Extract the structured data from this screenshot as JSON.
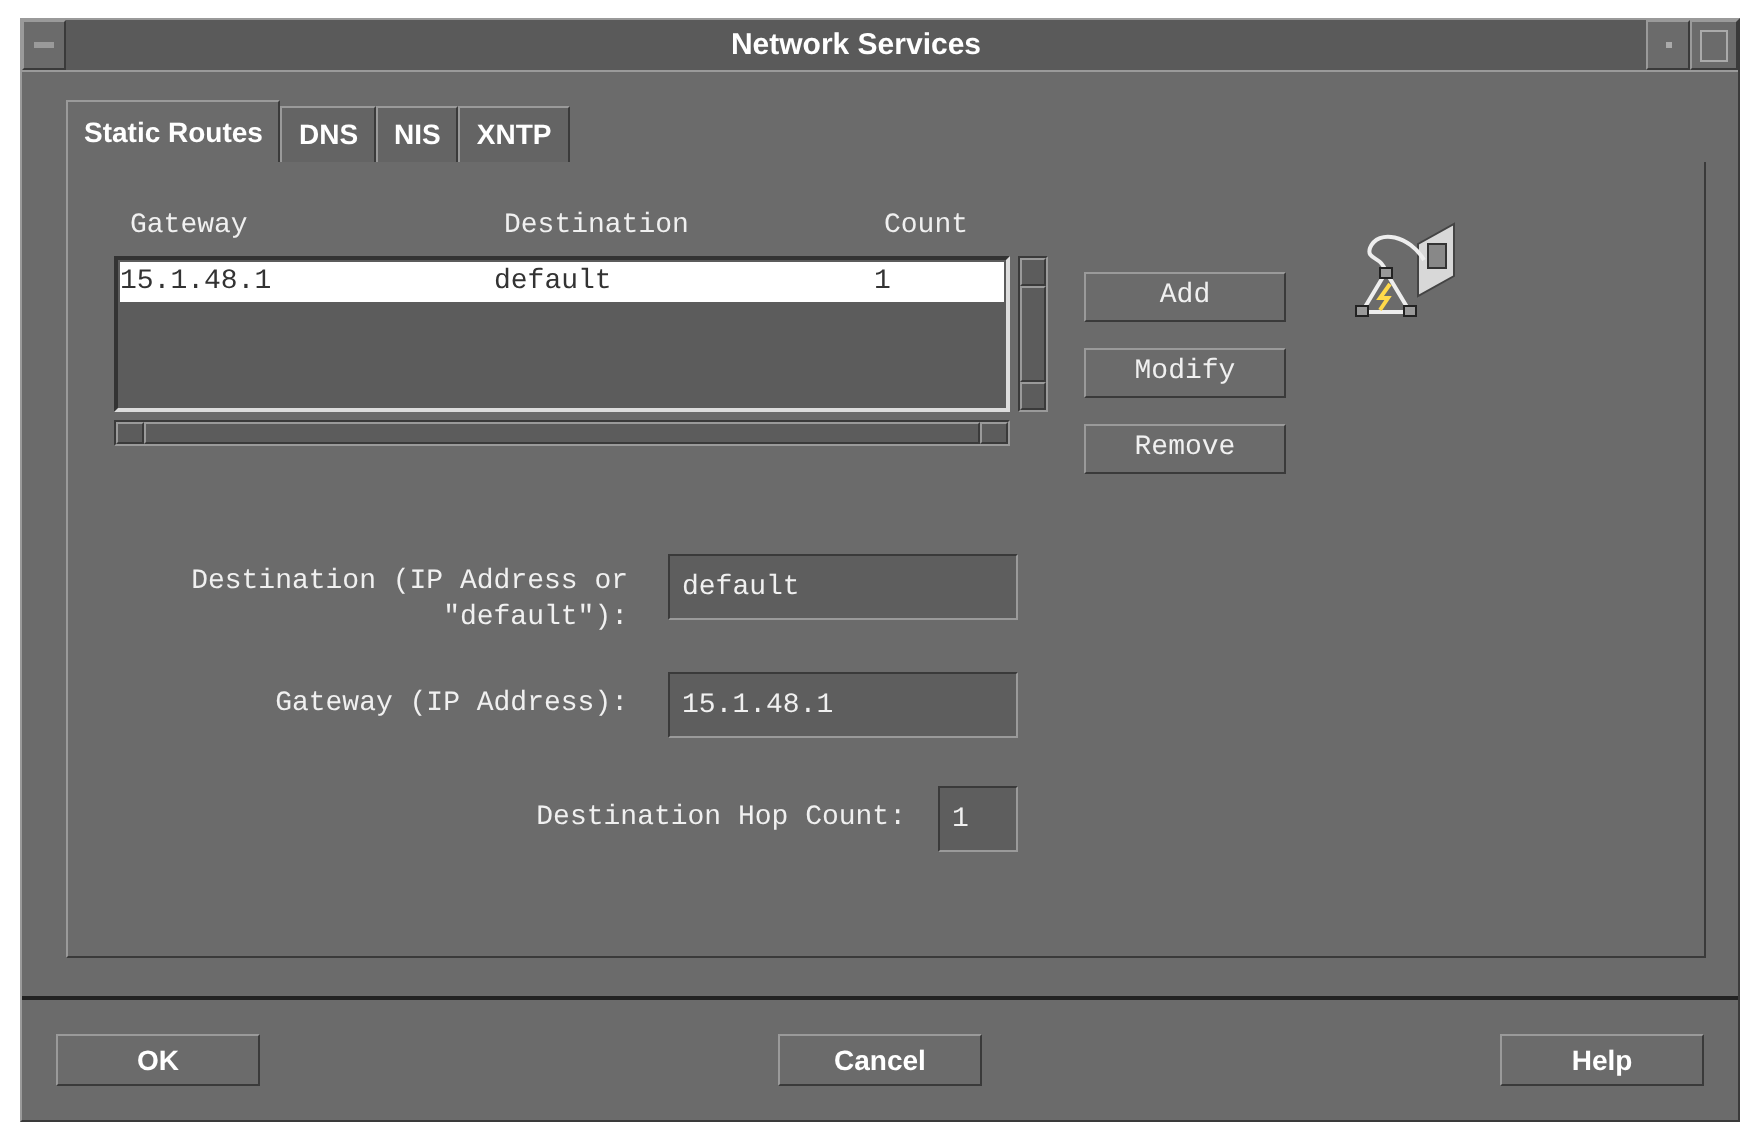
{
  "window": {
    "title": "Network Services"
  },
  "tabs": [
    {
      "label": "Static Routes",
      "selected": true
    },
    {
      "label": "DNS",
      "selected": false
    },
    {
      "label": "NIS",
      "selected": false
    },
    {
      "label": "XNTP",
      "selected": false
    }
  ],
  "routes": {
    "columns": [
      "Gateway",
      "Destination",
      "Count"
    ],
    "rows": [
      {
        "cells": [
          "15.1.48.1",
          "default",
          "1"
        ],
        "selected": true
      }
    ]
  },
  "route_buttons": [
    "Add",
    "Modify",
    "Remove"
  ],
  "fields": [
    {
      "label": "Destination (IP Address or \"default\"):",
      "value": "default"
    },
    {
      "label": "Gateway (IP Address):",
      "value": "15.1.48.1"
    },
    {
      "label": "Destination Hop Count:",
      "value": "1"
    }
  ],
  "dialog_buttons": [
    "OK",
    "Cancel",
    "Help"
  ]
}
